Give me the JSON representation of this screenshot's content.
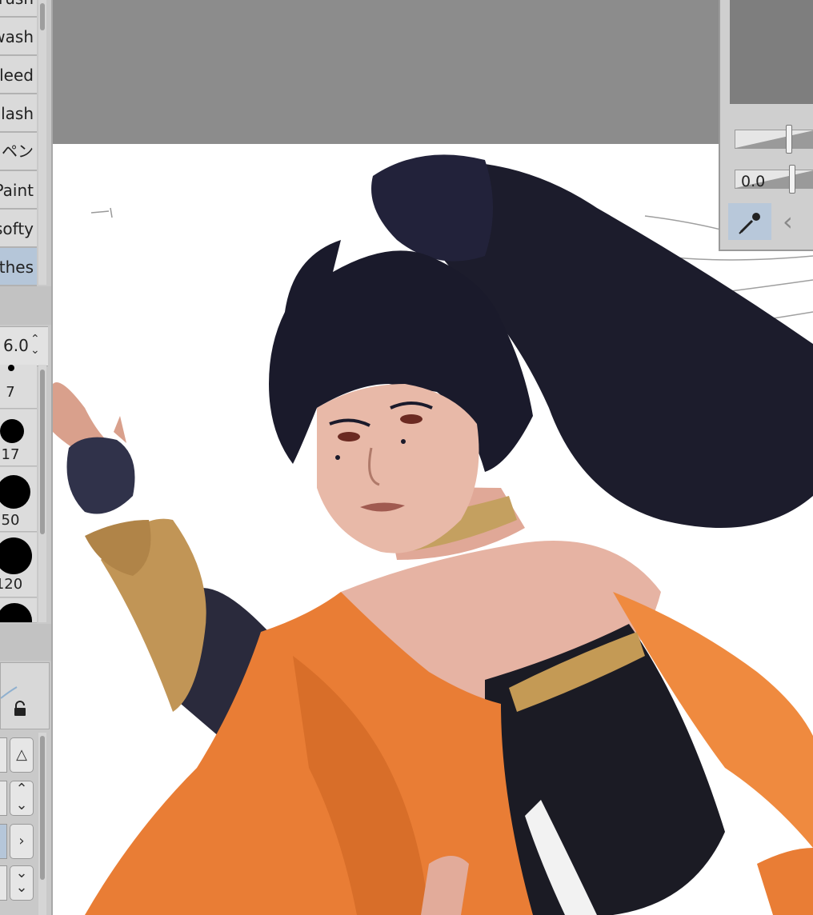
{
  "brush_list": [
    "rush",
    "wash",
    "leed",
    "plash",
    "ペン",
    "Paint",
    "softy",
    "thes"
  ],
  "selected_brush_index": 7,
  "brush_size": {
    "value": "6.0"
  },
  "size_presets": [
    "7",
    "17",
    "50",
    "120"
  ],
  "opacity_slider": {
    "value": "0.0"
  },
  "icons": {
    "eyedropper": "eyedropper-icon",
    "back": "chevron-left-icon",
    "lock": "lock-icon",
    "up_stepper": "chevron-up-down-icon",
    "triangle": "triangle-icon",
    "expand": "chevron-right-icon",
    "double_down": "double-chevron-down-icon"
  },
  "colors": {
    "selection": "#b5c6d9",
    "panel": "#c9c9c9",
    "canvas": "#ffffff",
    "hair": "#1c1c2c",
    "garment": "#e97d35",
    "skin": "#e6b3a3"
  }
}
